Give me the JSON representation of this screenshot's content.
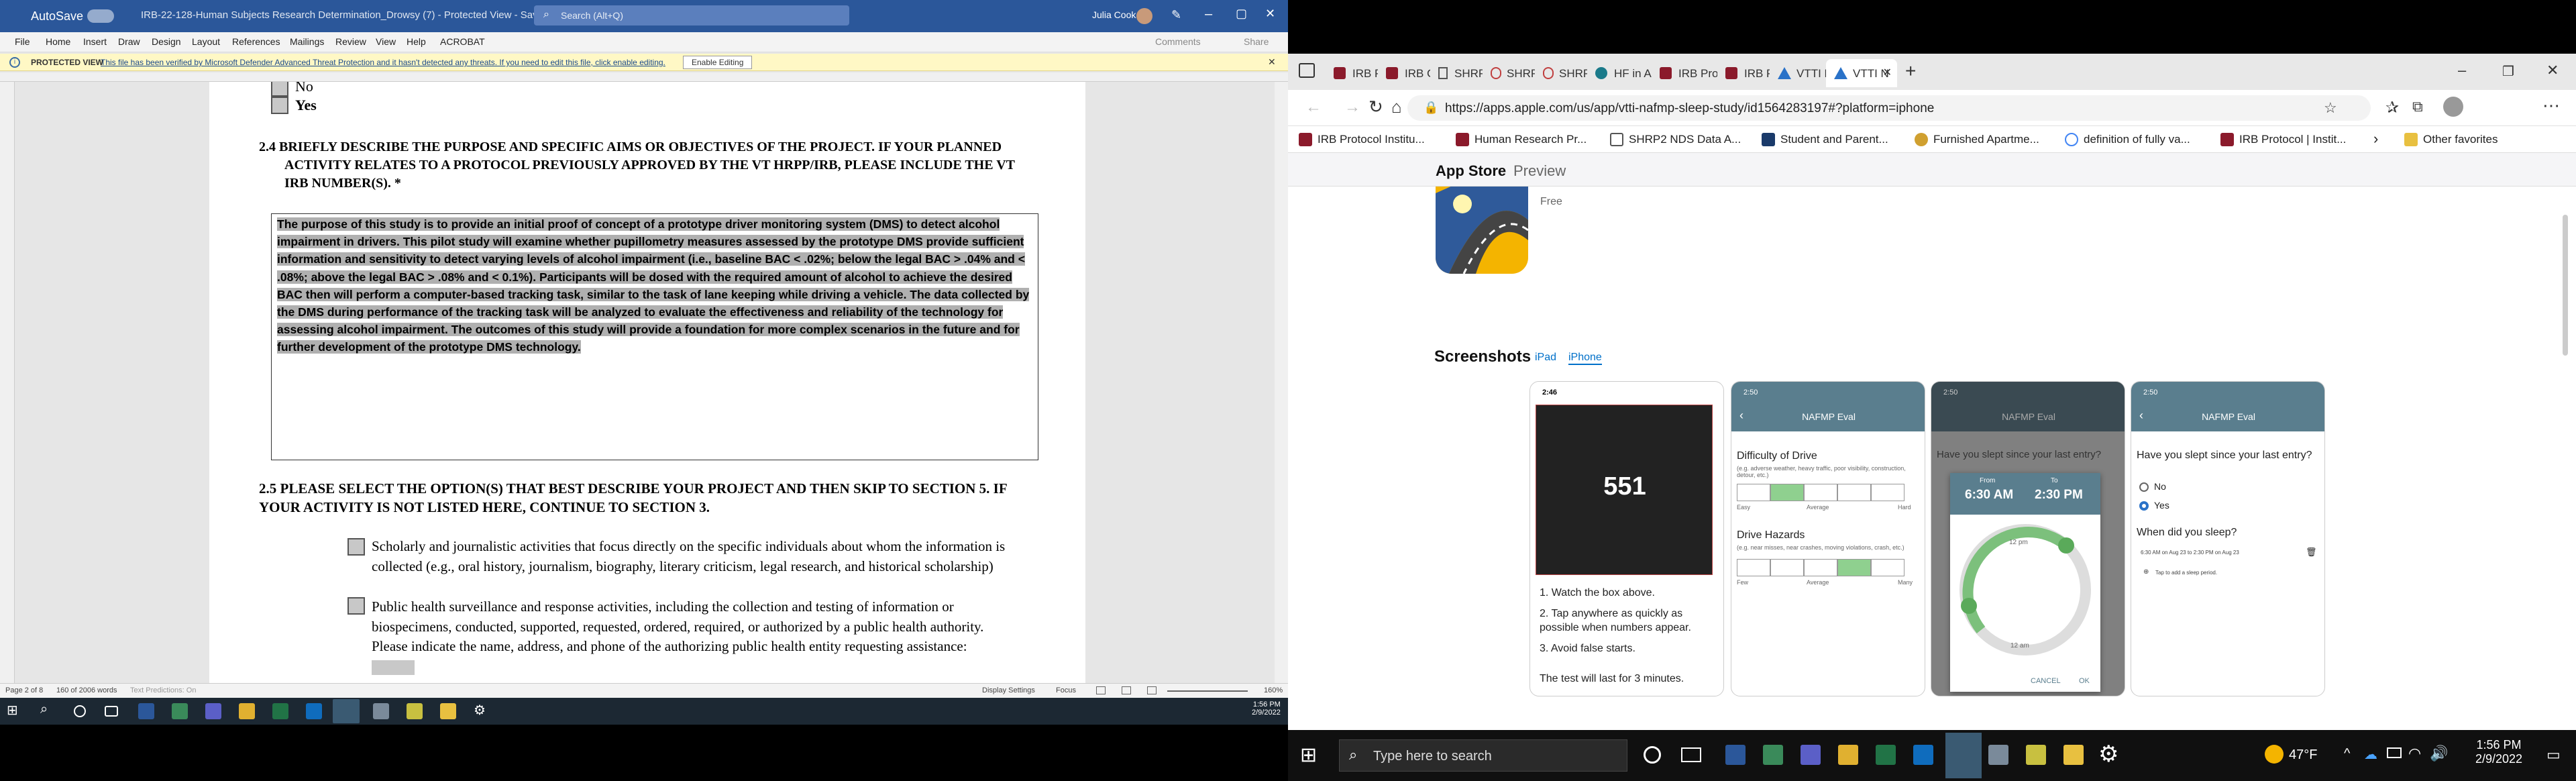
{
  "word": {
    "title": {
      "autosave": "AutoSave",
      "doc_name": "IRB-22-128-Human Subjects Research Determination_Drowsy (7)  -  Protected View  -  Saved to this PC",
      "search_placeholder": "Search (Alt+Q)",
      "user": "Julia Cook"
    },
    "ribbon_tabs": [
      "File",
      "Home",
      "Insert",
      "Draw",
      "Design",
      "Layout",
      "References",
      "Mailings",
      "Review",
      "View",
      "Help",
      "ACROBAT"
    ],
    "ribbon_right": {
      "comments": "Comments",
      "share": "Share"
    },
    "protected_view": {
      "label": "PROTECTED VIEW",
      "message": "This file has been verified by Microsoft Defender Advanced Threat Protection and it hasn't detected any threats. If you need to edit this file, click enable editing.",
      "button": "Enable Editing"
    },
    "doc": {
      "top_no": "No",
      "top_yes": "Yes",
      "q24": "2.4 BRIEFLY DESCRIBE THE PURPOSE AND SPECIFIC AIMS OR OBJECTIVES OF THE PROJECT.  IF YOUR PLANNED ACTIVITY RELATES TO A PROTOCOL PREVIOUSLY APPROVED BY THE VT HRPP/IRB, PLEASE INCLUDE THE VT IRB NUMBER(S). *",
      "answer": "The purpose of this study is to provide an initial proof of concept of a prototype driver monitoring system (DMS) to detect alcohol impairment in drivers. This pilot study will examine whether pupillometry measures assessed by the prototype DMS provide sufficient information and sensitivity to detect varying levels of alcohol impairment (i.e., baseline BAC < .02%; below the legal BAC > .04% and < .08%; above the legal BAC > .08% and < 0.1%). Participants will be dosed with the required amount of alcohol to achieve the desired BAC then will perform a computer-based tracking task, similar to the task of lane keeping while driving a vehicle. The data collected by the DMS during performance of the tracking task will be analyzed to evaluate the effectiveness and reliability of the technology for assessing alcohol impairment. The outcomes of this study will provide a foundation for more complex scenarios in the future and for further development of the prototype DMS technology.",
      "q25": "2.5 PLEASE SELECT THE OPTION(S) THAT BEST DESCRIBE YOUR PROJECT AND THEN SKIP TO SECTION 5. IF YOUR ACTIVITY IS NOT LISTED HERE, CONTINUE TO SECTION 3.",
      "opt1": "Scholarly and journalistic activities that focus directly on the specific individuals about whom the information is collected (e.g., oral history, journalism, biography, literary criticism, legal research, and historical scholarship)",
      "opt2": "Public health surveillance and response activities, including the collection and testing of information or biospecimens, conducted, supported, requested, ordered, required, or authorized by a public health authority. Please indicate the name, address, and phone of the authorizing public health entity requesting assistance:"
    },
    "status": {
      "page": "Page 2 of 8",
      "words": "160 of 2006 words",
      "access": "Text Predictions: On",
      "display": "Display Settings",
      "focus": "Focus",
      "zoom": "160%"
    },
    "clock": {
      "time": "1:56 PM",
      "date": "2/9/2022"
    }
  },
  "edge": {
    "tabs": [
      "IRB Pro",
      "IRB Co",
      "SHRP2",
      "SHRP2",
      "SHRP2",
      "HF in A",
      "IRB Pro",
      "IRB Pr",
      "VTTI N",
      "VTTI N"
    ],
    "url": "https://apps.apple.com/us/app/vtti-nafmp-sleep-study/id1564283197#?platform=iphone",
    "bookmarks": [
      "IRB Protocol Institu...",
      "Human Research Pr...",
      "SHRP2 NDS Data A...",
      "Student and Parent...",
      "Furnished Apartme...",
      "definition of fully va...",
      "IRB Protocol | Instit..."
    ],
    "other_favorites": "Other favorites",
    "store": {
      "brand": "App Store",
      "preview": "Preview",
      "price": "Free",
      "screenshots": "Screenshots",
      "ipad": "iPad",
      "iphone": "iPhone"
    },
    "shot1": {
      "time": "2:46",
      "number": "551",
      "steps": [
        "1. Watch the box above.",
        "2. Tap anywhere as quickly as possible when numbers appear.",
        "3. Avoid false starts."
      ],
      "note": "The test will last for 3 minutes."
    },
    "shot2": {
      "time": "2:50",
      "header": "NAFMP Eval",
      "q1": "Difficulty of Drive",
      "q1_hint": "(e.g. adverse weather, heavy traffic, poor visibility, construction, detour, etc.)",
      "scale1": [
        "Easy",
        "Average",
        "Hard"
      ],
      "q2": "Drive Hazards",
      "q2_hint": "(e.g. near misses, near crashes, moving violations, crash, etc.)",
      "scale2": [
        "Few",
        "Average",
        "Many"
      ]
    },
    "shot3": {
      "time": "2:50",
      "header": "NAFMP Eval",
      "q": "Have you slept since your last entry?",
      "from_label": "From",
      "to_label": "To",
      "from": "6:30 AM",
      "to": "2:30 PM",
      "top": "12 pm",
      "bottom": "12 am",
      "cancel": "CANCEL",
      "ok": "OK"
    },
    "shot4": {
      "time": "2:50",
      "header": "NAFMP Eval",
      "q": "Have you slept since your last entry?",
      "no": "No",
      "yes": "Yes",
      "q2": "When did you sleep?",
      "entry": "6:30 AM on Aug 23 to 2:30 PM on Aug 23",
      "add": "Tap to add a sleep period."
    }
  },
  "taskbar": {
    "search": "Type here to search",
    "temp": "47°F",
    "time": "1:56 PM",
    "date": "2/9/2022"
  }
}
